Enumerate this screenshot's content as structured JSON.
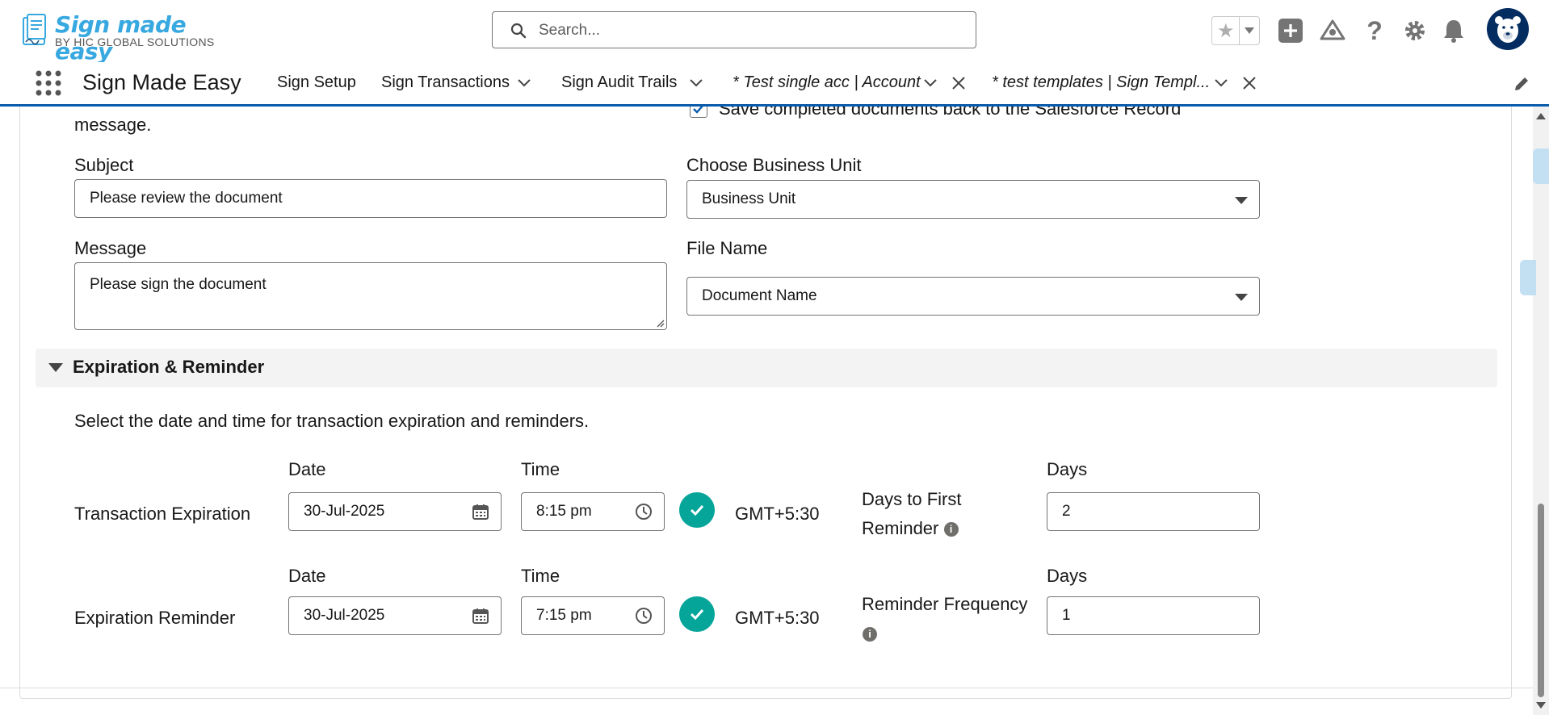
{
  "header": {
    "brand_name": "Sign made easy",
    "brand_sub": "BY HIC GLOBAL SOLUTIONS",
    "search_placeholder": "Search..."
  },
  "nav": {
    "app_name": "Sign Made Easy",
    "items": [
      {
        "label": "Sign Setup"
      },
      {
        "label": "Sign Transactions"
      },
      {
        "label": "Sign Audit Trails"
      },
      {
        "label": "* Test single acc | Account"
      },
      {
        "label": "* test templates | Sign Templ..."
      }
    ]
  },
  "form": {
    "message_hint": "message.",
    "save_completed_label": "Save completed documents back to the Salesforce Record",
    "subject_label": "Subject",
    "subject_value": "Please review the document",
    "business_unit_label": "Choose Business Unit",
    "business_unit_value": "Business Unit",
    "message_label": "Message",
    "message_value": "Please sign the document",
    "file_name_label": "File Name",
    "file_name_value": "Document Name"
  },
  "expiration": {
    "section_title": "Expiration & Reminder",
    "description": "Select the date and time for transaction expiration and reminders.",
    "rows": [
      {
        "label": "Transaction Expiration",
        "date_label": "Date",
        "date": "30-Jul-2025",
        "time_label": "Time",
        "time": "8:15 pm",
        "timezone": "GMT+5:30",
        "days_label_line1": "Days to First",
        "days_label_line2": "Reminder",
        "days_header": "Days",
        "days_value": "2"
      },
      {
        "label": "Expiration Reminder",
        "date_label": "Date",
        "date": "30-Jul-2025",
        "time_label": "Time",
        "time": "7:15 pm",
        "timezone": "GMT+5:30",
        "days_label_line1": "Reminder Frequency",
        "days_label_line2": "",
        "days_header": "Days",
        "days_value": "1"
      }
    ]
  },
  "colors": {
    "brand_blue": "#38a8e0",
    "nav_accent": "#0b5cab",
    "success_teal": "#06a59a"
  }
}
